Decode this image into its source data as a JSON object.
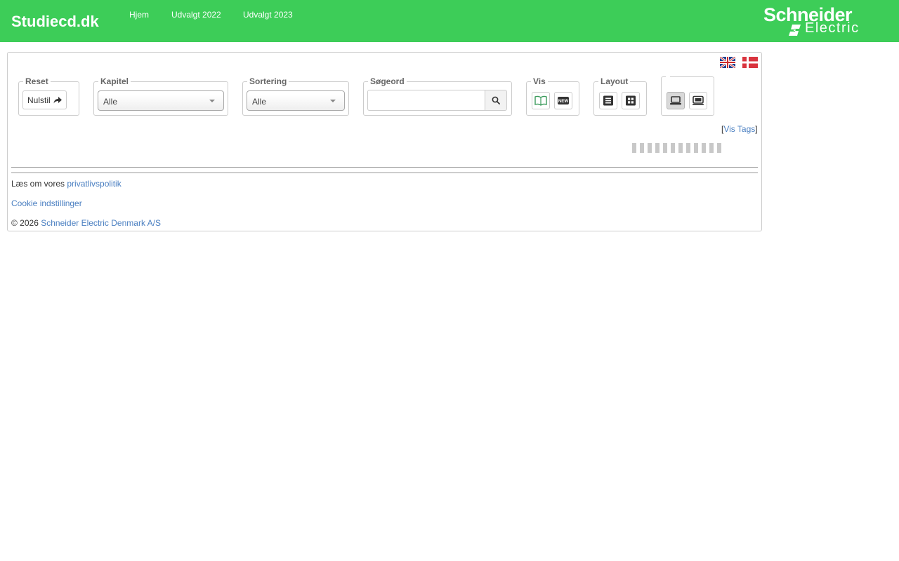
{
  "header": {
    "brand": "Studiecd.dk",
    "nav": [
      "Hjem",
      "Udvalgt 2022",
      "Udvalgt 2023"
    ],
    "logo": {
      "word1": "Schneider",
      "word2": "Electric",
      "icon": "schneider-electric-logo"
    }
  },
  "languages": [
    {
      "code": "en",
      "icon": "uk-flag-icon"
    },
    {
      "code": "da",
      "icon": "danish-flag-icon"
    }
  ],
  "filters": {
    "reset": {
      "legend": "Reset",
      "button_label": "Nulstil",
      "icon": "share-arrow-icon"
    },
    "chapter": {
      "legend": "Kapitel",
      "value": "Alle"
    },
    "sort": {
      "legend": "Sortering",
      "value": "Alle"
    },
    "search": {
      "legend": "Søgeord",
      "value": "",
      "icon": "search-icon"
    },
    "show": {
      "legend": "Vis",
      "buttons": [
        "open-book-icon",
        "new-badge-icon"
      ]
    },
    "layout": {
      "legend": "Layout",
      "buttons": [
        "list-icon",
        "grid-icon"
      ]
    },
    "device": {
      "legend": "",
      "buttons": [
        "laptop-icon",
        "monitor-icon"
      ],
      "active": 0
    }
  },
  "tags_link": {
    "open_bracket": "[",
    "label": "Vis Tags",
    "close_bracket": "]"
  },
  "footer": {
    "privacy_prefix": "Læs om vores ",
    "privacy_link": "privatlivspolitik",
    "cookie_link": "Cookie indstillinger",
    "copyright_prefix": "© 2026 ",
    "company_link": "Schneider Electric Denmark A/S"
  },
  "colors": {
    "brand_green": "#3dcd58",
    "link": "#4a7fc1"
  }
}
